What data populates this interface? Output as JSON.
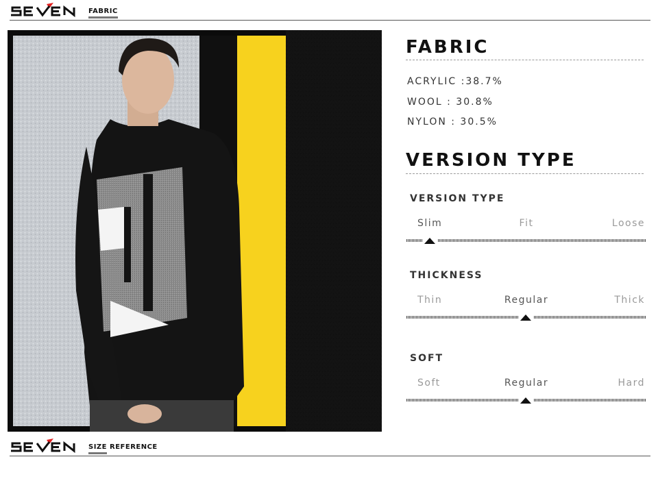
{
  "header": {
    "brand": "SEVEN",
    "section": "FABRIC"
  },
  "footer": {
    "brand": "SEVEN",
    "section_bold": "SIZE",
    "section_rest": "REFERENCE"
  },
  "photo": {
    "description_icon": "model-photo"
  },
  "fabric": {
    "title": "FABRIC",
    "lines": [
      "ACRYLIC :38.7%",
      "WOOL : 30.8%",
      "NYLON : 30.5%"
    ]
  },
  "version_type": {
    "title": "VERSION TYPE",
    "scales": [
      {
        "title": "VERSION TYPE",
        "options": [
          "Slim",
          "Fit",
          "Loose"
        ],
        "selected": 0
      },
      {
        "title": "THICKNESS",
        "options": [
          "Thin",
          "Regular",
          "Thick"
        ],
        "selected": 1
      },
      {
        "title": "SOFT",
        "options": [
          "Soft",
          "Regular",
          "Hard"
        ],
        "selected": 1
      }
    ]
  },
  "colors": {
    "accent_yellow": "#f7d21e",
    "brand_red": "#e02020",
    "text_dark": "#111111"
  }
}
